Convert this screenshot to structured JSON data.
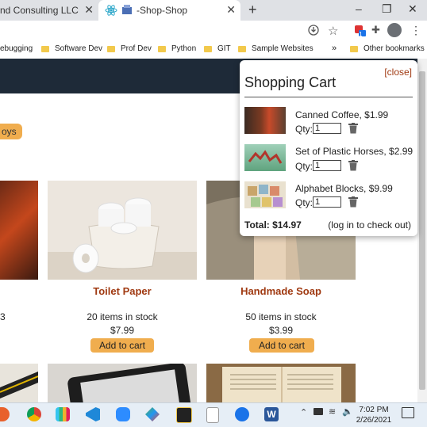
{
  "browser": {
    "tabs": [
      {
        "label": "nd Consulting LLC",
        "active": false
      },
      {
        "label": "-Shop-Shop",
        "active": true
      }
    ],
    "new_tab_icon": "plus-icon",
    "window_controls": [
      "minimize-icon",
      "restore-icon",
      "close-icon"
    ],
    "bookmarks": [
      {
        "label": "ebugging"
      },
      {
        "label": "Software Dev"
      },
      {
        "label": "Prof Dev"
      },
      {
        "label": "Python"
      },
      {
        "label": "GIT"
      },
      {
        "label": "Sample Websites"
      }
    ],
    "overflow_label": "»",
    "other_bookmarks": "Other bookmarks",
    "extension_badge": "1"
  },
  "page": {
    "category_chip": "oys",
    "products": [
      {
        "name": "Toilet Paper",
        "stock": "20 items in stock",
        "price": "$7.99",
        "button": "Add to cart"
      },
      {
        "name": "Handmade Soap",
        "stock": "50 items in stock",
        "price": "$3.99",
        "button": "Add to cart"
      }
    ],
    "partial_left_text": "3"
  },
  "cart": {
    "title": "Shopping Cart",
    "close_label": "[close]",
    "items": [
      {
        "name": "Canned Coffee, $1.99",
        "qty_label": "Qty:",
        "qty": "1"
      },
      {
        "name": "Set of Plastic Horses, $2.99",
        "qty_label": "Qty:",
        "qty": "1"
      },
      {
        "name": "Alphabet Blocks, $9.99",
        "qty_label": "Qty:",
        "qty": "1"
      }
    ],
    "total": "Total: $14.97",
    "checkout_note": "(log in to check out)"
  },
  "taskbar": {
    "time": "7:02 PM",
    "date": "2/26/2021"
  },
  "colors": {
    "accent_button": "#f0ad4e",
    "product_name": "#a03a12",
    "navbar": "#1e2a38"
  }
}
